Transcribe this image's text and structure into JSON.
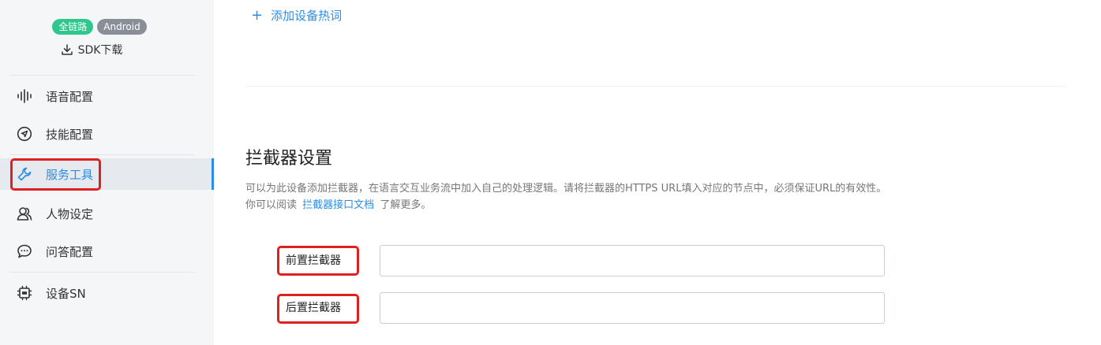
{
  "sidebar": {
    "badges": [
      "全链路",
      "Android"
    ],
    "sdk_download": "SDK下载",
    "items": [
      {
        "label": "语音配置",
        "icon": "voice-wave-icon"
      },
      {
        "label": "技能配置",
        "icon": "navigation-icon"
      },
      {
        "label": "服务工具",
        "icon": "wrench-icon",
        "active": true
      },
      {
        "label": "人物设定",
        "icon": "persona-icon"
      },
      {
        "label": "问答配置",
        "icon": "chat-bubble-icon"
      },
      {
        "label": "设备SN",
        "icon": "chip-icon"
      }
    ]
  },
  "main": {
    "add_hotword": "添加设备热词",
    "section_title": "拦截器设置",
    "description_line1": "可以为此设备添加拦截器，在语言交互业务流中加入自己的处理逻辑。请将拦截器的HTTPS URL填入对应的节点中，必须保证URL的有效性。",
    "description_line2_prefix": "你可以阅读",
    "description_link": "拦截器接口文档",
    "description_line2_suffix": "了解更多。",
    "pre_interceptor_label": "前置拦截器",
    "pre_interceptor_value": "",
    "post_interceptor_label": "后置拦截器",
    "post_interceptor_value": ""
  },
  "colors": {
    "accent": "#2b8de6",
    "badge_green": "#2fc78d",
    "badge_gray": "#8a8f97",
    "highlight_red": "#e02020"
  }
}
